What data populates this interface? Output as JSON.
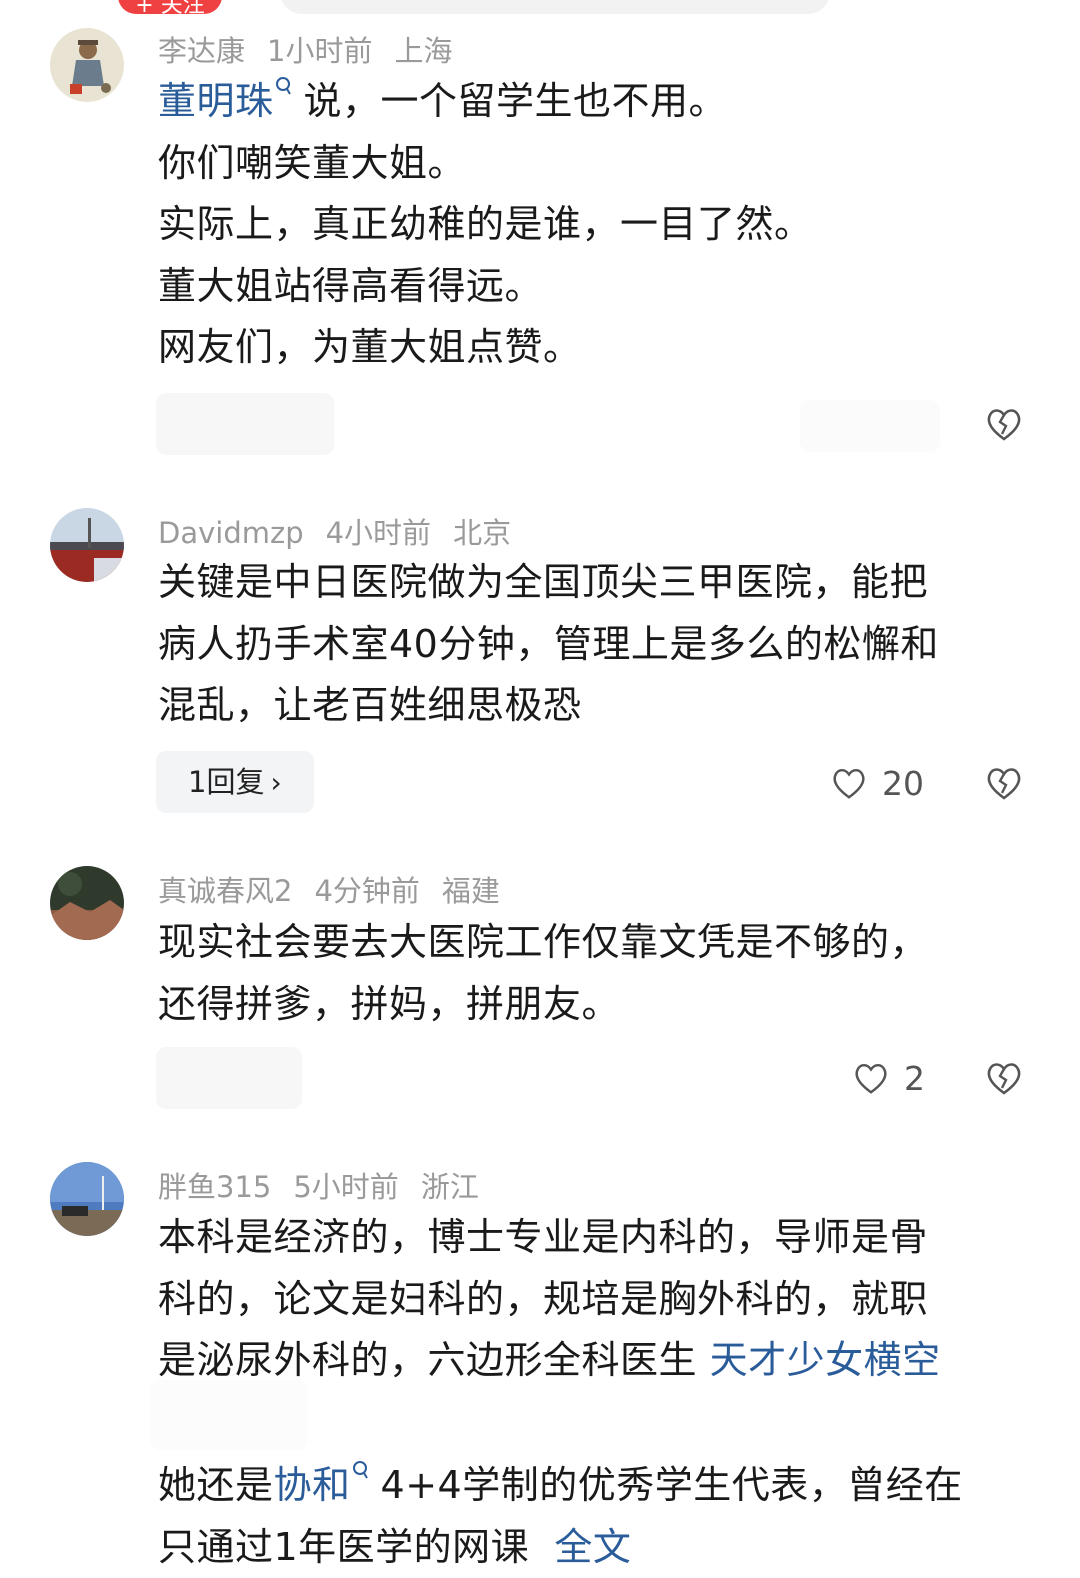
{
  "top": {
    "follow_label": "+ 关注"
  },
  "comments": [
    {
      "user": "李达康",
      "time": "1小时前",
      "location": "上海",
      "mention": "董明珠",
      "lines": [
        "说，一个留学生也不用。",
        "你们嘲笑董大姐。",
        "实际上，真正幼稚的是谁，一目了然。",
        "董大姐站得高看得远。",
        "网友们，为董大姐点赞。"
      ]
    },
    {
      "user": "Davidmzp",
      "time": "4小时前",
      "location": "北京",
      "lines": [
        "关键是中日医院做为全国顶尖三甲医院，能把",
        "病人扔手术室40分钟，管理上是多么的松懈和",
        "混乱，让老百姓细思极恐"
      ],
      "reply_label": "1回复",
      "likes": "20"
    },
    {
      "user": "真诚春风2",
      "time": "4分钟前",
      "location": "福建",
      "lines": [
        "现实社会要去大医院工作仅靠文凭是不够的，",
        "还得拼爹，拼妈，拼朋友。"
      ],
      "likes": "2"
    },
    {
      "user": "胖鱼315",
      "time": "5小时前",
      "location": "浙江",
      "lines": [
        "本科是经济的，博士专业是内科的，导师是骨",
        "科的，论文是妇科的，规培是胸外科的，就职"
      ],
      "line3_text": "是泌尿外科的，六边形全科医生 ",
      "line3_link": "天才少女横空",
      "line4_prefix": "她还是",
      "line4_mention": "协和",
      "line4_rest": "4+4学制的优秀学生代表，曾经在",
      "line5_text": "只通过1年医学的网课",
      "line5_link": "全文"
    }
  ],
  "colors": {
    "link": "#2b5c9a",
    "meta": "#9a9a9a",
    "accent": "#f04142"
  }
}
